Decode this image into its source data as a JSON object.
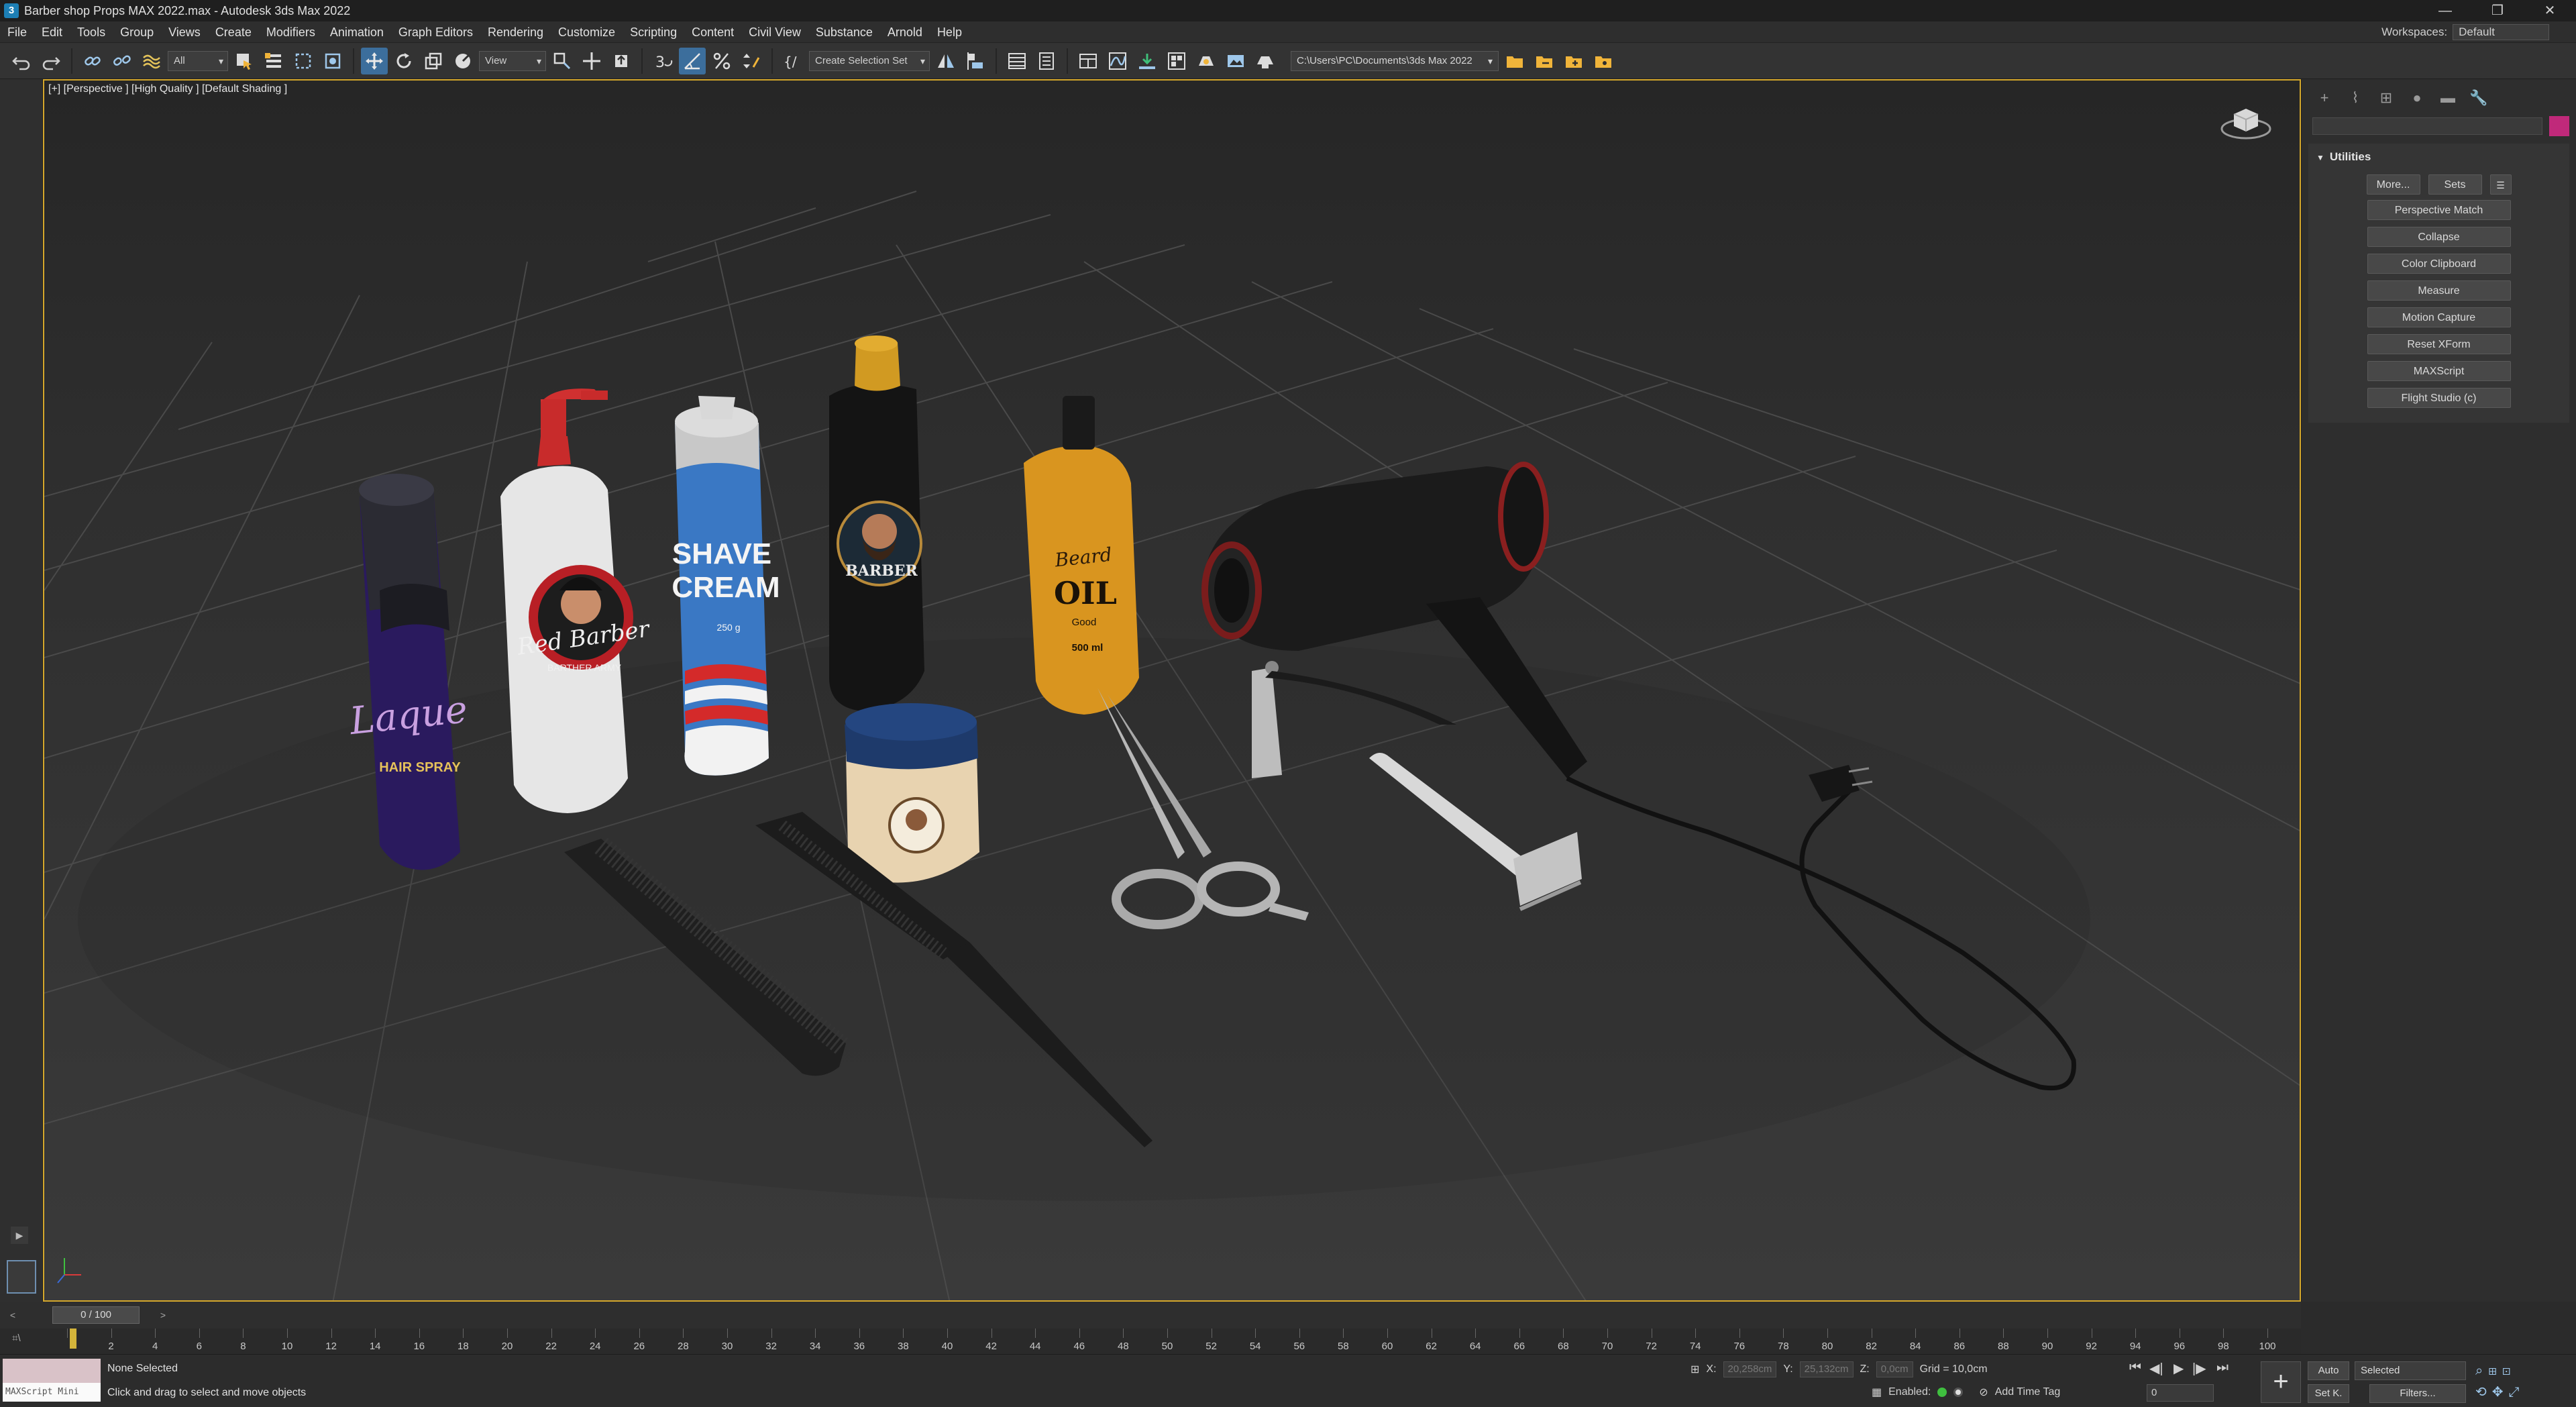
{
  "window": {
    "title": "Barber shop Props MAX 2022.max - Autodesk 3ds Max 2022",
    "logo": "3",
    "controls": [
      "—",
      "❐",
      "✕"
    ]
  },
  "menu": [
    "File",
    "Edit",
    "Tools",
    "Group",
    "Views",
    "Create",
    "Modifiers",
    "Animation",
    "Graph Editors",
    "Rendering",
    "Customize",
    "Scripting",
    "Content",
    "Civil View",
    "Substance",
    "Arnold",
    "Help"
  ],
  "workspaces": {
    "label": "Workspaces:",
    "value": "Default"
  },
  "toolbar": {
    "selection_filter": "All",
    "ref_coord": "View",
    "selection_set": "Create Selection Set",
    "project_path": "C:\\Users\\PC\\Documents\\3ds Max 2022",
    "snap_toggle_label": "3",
    "icons": [
      "undo-icon",
      "redo-icon",
      "link-icon",
      "unlink-icon",
      "bind-space-warp-icon",
      "select-object-icon",
      "select-by-name-icon",
      "rect-region-icon",
      "window-crossing-icon",
      "select-move-icon",
      "select-rotate-icon",
      "select-scale-icon",
      "placement-icon",
      "mirror-icon",
      "align-icon",
      "layer-explorer-icon",
      "scene-explorer-icon",
      "curve-editor-icon",
      "schematic-view-icon",
      "material-editor-icon",
      "render-setup-icon",
      "render-frame-icon",
      "render-icon"
    ]
  },
  "viewport": {
    "label": "[+] [Perspective ] [High Quality ] [Default Shading ]",
    "products": {
      "hair_spray": {
        "brand": "Laque",
        "text": "HAIR SPRAY",
        "color": "#2a1a5e"
      },
      "pump_bottle": {
        "brand": "Red Barber",
        "text": "BARTHER ARMY",
        "color": "#e8e8e8"
      },
      "shave_cream": {
        "line1": "SHAVE",
        "line2": "CREAM",
        "sub": "250 g",
        "color": "#3a78c4"
      },
      "barber_bottle": {
        "text": "BARBER",
        "color": "#141414",
        "cap": "#d19a22"
      },
      "oil_bottle": {
        "brand": "Beard",
        "line1": "OIL",
        "line2": "Good",
        "sub": "500 ml",
        "color": "#d9951f"
      },
      "wax_jar": {
        "color": "#e8d3b0",
        "lid": "#1e3a6b"
      }
    }
  },
  "command_panel": {
    "tab_icons": [
      "create-tab-icon",
      "modify-tab-icon",
      "hierarchy-tab-icon",
      "motion-tab-icon",
      "display-tab-icon",
      "utilities-tab-icon"
    ],
    "tab_glyphs": [
      "+",
      "⌇",
      "⊞",
      "●",
      "▬",
      "🔧"
    ],
    "rollout_title": "Utilities",
    "more_label": "More...",
    "sets_label": "Sets",
    "config_glyph": "☰",
    "utilities": [
      "Perspective Match",
      "Collapse",
      "Color Clipboard",
      "Measure",
      "Motion Capture",
      "Reset XForm",
      "MAXScript",
      "Flight Studio (c)"
    ],
    "object_color": "#c0297a"
  },
  "timeline": {
    "frame_display": "0 / 100",
    "prev": "<",
    "next": ">",
    "ticks": [
      "0",
      "2",
      "4",
      "6",
      "8",
      "10",
      "12",
      "14",
      "16",
      "18",
      "20",
      "22",
      "24",
      "26",
      "28",
      "30",
      "32",
      "34",
      "36",
      "38",
      "40",
      "42",
      "44",
      "46",
      "48",
      "50",
      "52",
      "54",
      "56",
      "58",
      "60",
      "62",
      "64",
      "66",
      "68",
      "70",
      "72",
      "74",
      "76",
      "78",
      "80",
      "82",
      "84",
      "86",
      "88",
      "90",
      "92",
      "94",
      "96",
      "98",
      "100"
    ]
  },
  "status": {
    "maxscript_label": "MAXScript Mini",
    "selection": "None Selected",
    "prompt": "Click and drag to select and move objects",
    "x_label": "X:",
    "x_value": "20,258cm",
    "y_label": "Y:",
    "y_value": "25,132cm",
    "z_label": "Z:",
    "z_value": "0,0cm",
    "grid": "Grid = 10,0cm",
    "enabled_label": "Enabled:",
    "add_time_tag": "Add Time Tag",
    "frame_field": "0",
    "auto_label": "Auto",
    "setk_label": "Set K.",
    "selected_label": "Selected",
    "filters_label": "Filters...",
    "playback": [
      "⏮",
      "◀|",
      "▶",
      "|▶",
      "⏭"
    ]
  }
}
